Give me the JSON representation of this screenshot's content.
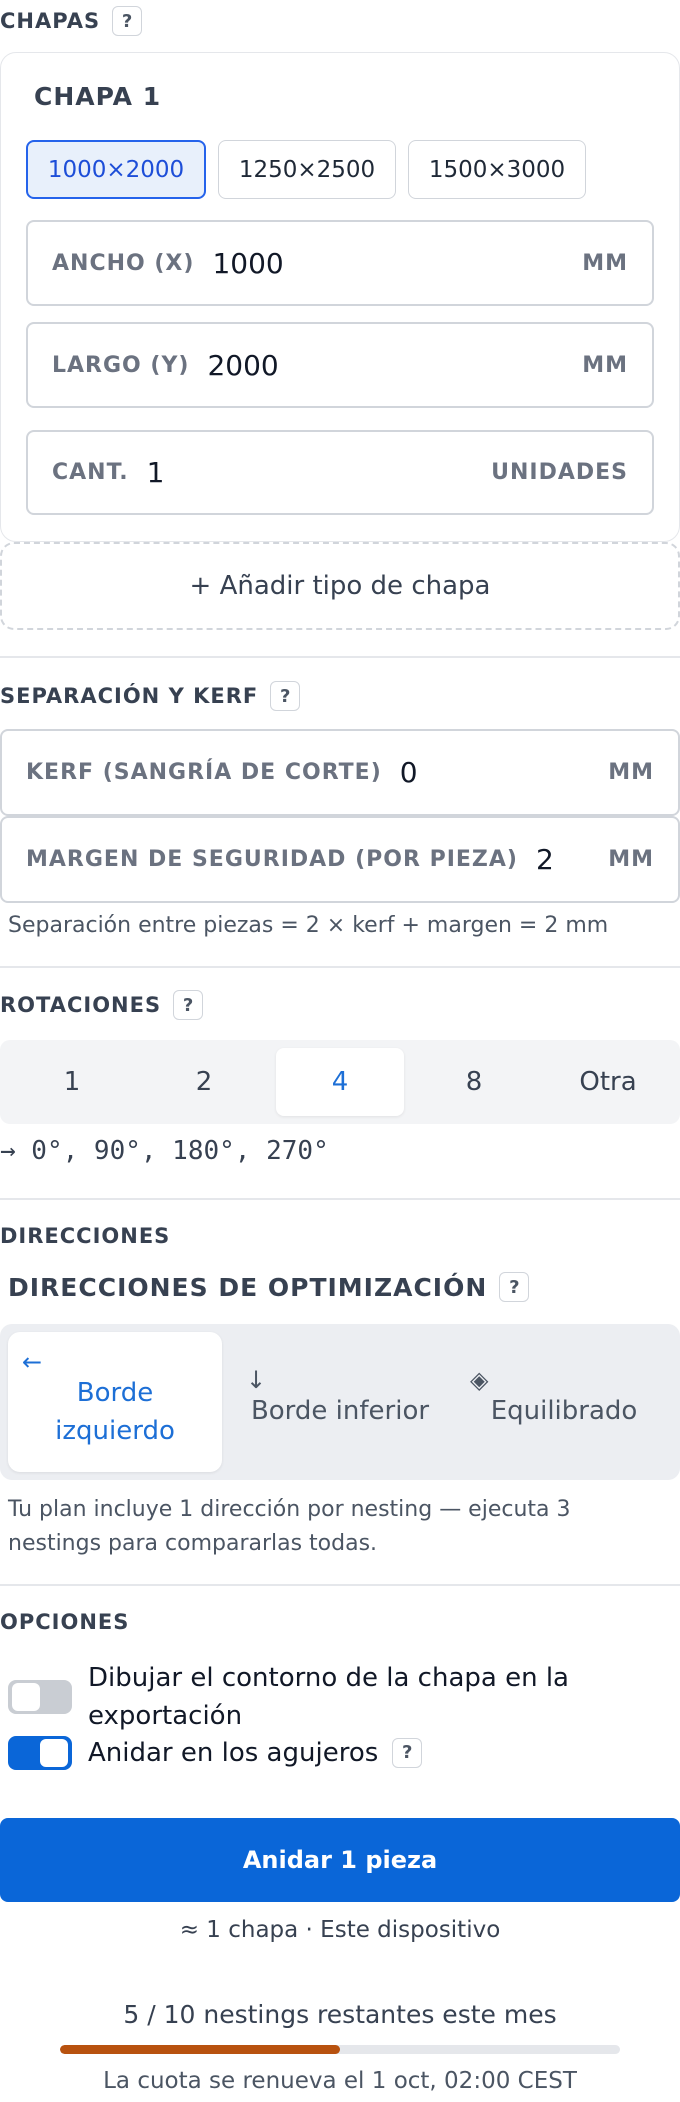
{
  "sheets": {
    "section_title": "CHAPAS",
    "help": "?",
    "card_title": "CHAPA 1",
    "presets": [
      {
        "label": "1000×2000",
        "active": true
      },
      {
        "label": "1250×2500",
        "active": false
      },
      {
        "label": "1500×3000",
        "active": false
      }
    ],
    "width": {
      "label": "ANCHO (X)",
      "value": "1000",
      "unit": "MM"
    },
    "length": {
      "label": "LARGO (Y)",
      "value": "2000",
      "unit": "MM"
    },
    "quantity": {
      "label": "CANT.",
      "value": "1",
      "unit": "UNIDADES"
    },
    "add_button": "+ Añadir tipo de chapa"
  },
  "spacing": {
    "section_title": "SEPARACIÓN Y KERF",
    "help": "?",
    "kerf": {
      "label": "KERF (SANGRÍA DE CORTE)",
      "value": "0",
      "unit": "MM"
    },
    "margin": {
      "label": "MARGEN DE SEGURIDAD (POR PIEZA)",
      "value": "2",
      "unit": "MM"
    },
    "note": "Separación entre piezas = 2 × kerf + margen = 2 mm"
  },
  "rotations": {
    "section_title": "ROTACIONES",
    "help": "?",
    "options": [
      "1",
      "2",
      "4",
      "8",
      "Otra"
    ],
    "selected": "4",
    "angles": "→ 0°, 90°, 180°, 270°"
  },
  "directions": {
    "section_title": "DIRECCIONES",
    "subtitle": "DIRECCIONES DE OPTIMIZACIÓN",
    "help": "?",
    "items": [
      {
        "icon": "arrow-left-icon",
        "glyph": "←",
        "line1": "Borde",
        "line2": "izquierdo",
        "active": true
      },
      {
        "icon": "arrow-down-icon",
        "glyph": "↓",
        "line1": "Borde inferior",
        "line2": "",
        "active": false
      },
      {
        "icon": "layers-icon",
        "glyph": "◈",
        "line1": "Equilibrado",
        "line2": "",
        "active": false
      }
    ],
    "note_line1": "Tu plan incluye 1 dirección por nesting — ejecuta 3",
    "note_line2": "nestings para compararlas todas."
  },
  "options": {
    "section_title": "OPCIONES",
    "outline": {
      "line1": "Dibujar el contorno de la chapa en la",
      "line2": "exportación",
      "enabled": false
    },
    "holes": {
      "label": "Anidar en los agujeros",
      "help": "?",
      "enabled": true
    }
  },
  "action": {
    "button": "Anidar 1 pieza",
    "summary": "≈ 1 chapa · Este dispositivo"
  },
  "quota": {
    "text": "5 / 10 nestings restantes este mes",
    "used_fraction": 0.5,
    "renew": "La cuota se renueva el 1 oct, 02:00 CEST"
  },
  "colors": {
    "accent": "#0a66d8",
    "progress": "#b8520f",
    "toggle_on": "#0a66d8",
    "toggle_off": "#c9cdd3"
  }
}
